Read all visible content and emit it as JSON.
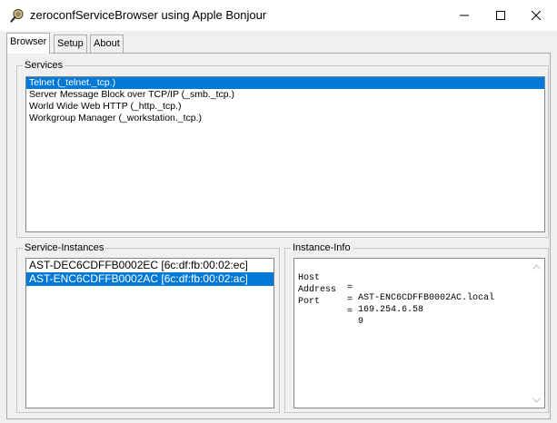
{
  "window": {
    "title": "zeroconfServiceBrowser using Apple Bonjour",
    "icon": "magnifier-icon",
    "controls": {
      "minimize": "─",
      "maximize": "☐",
      "close": "✕"
    }
  },
  "tabs": [
    {
      "label": "Browser",
      "active": true
    },
    {
      "label": "Setup",
      "active": false
    },
    {
      "label": "About",
      "active": false
    }
  ],
  "services": {
    "title": "Services",
    "items": [
      {
        "label": "Telnet (_telnet._tcp.)",
        "selected": true
      },
      {
        "label": "Server Message Block over TCP/IP (_smb._tcp.)",
        "selected": false
      },
      {
        "label": "World Wide Web HTTP (_http._tcp.)",
        "selected": false
      },
      {
        "label": "Workgroup Manager (_workstation._tcp.)",
        "selected": false
      }
    ]
  },
  "instances": {
    "title": "Service-Instances",
    "items": [
      {
        "label": "AST-DEC6CDFFB0002EC [6c:df:fb:00:02:ec]",
        "selected": false
      },
      {
        "label": "AST-ENC6CDFFB0002AC [6c:df:fb:00:02:ac]",
        "selected": true
      }
    ]
  },
  "info": {
    "title": "Instance-Info",
    "rows": [
      {
        "key": "Host",
        "eq": "=",
        "value": "AST-ENC6CDFFB0002AC.local"
      },
      {
        "key": "Address",
        "eq": "=",
        "value": "169.254.6.58"
      },
      {
        "key": "Port",
        "eq": "=",
        "value": "9"
      }
    ],
    "scroll_up": "▲",
    "scroll_down": "▼"
  },
  "colors": {
    "selection": "#0078d7",
    "selection_text": "#ffffff"
  }
}
